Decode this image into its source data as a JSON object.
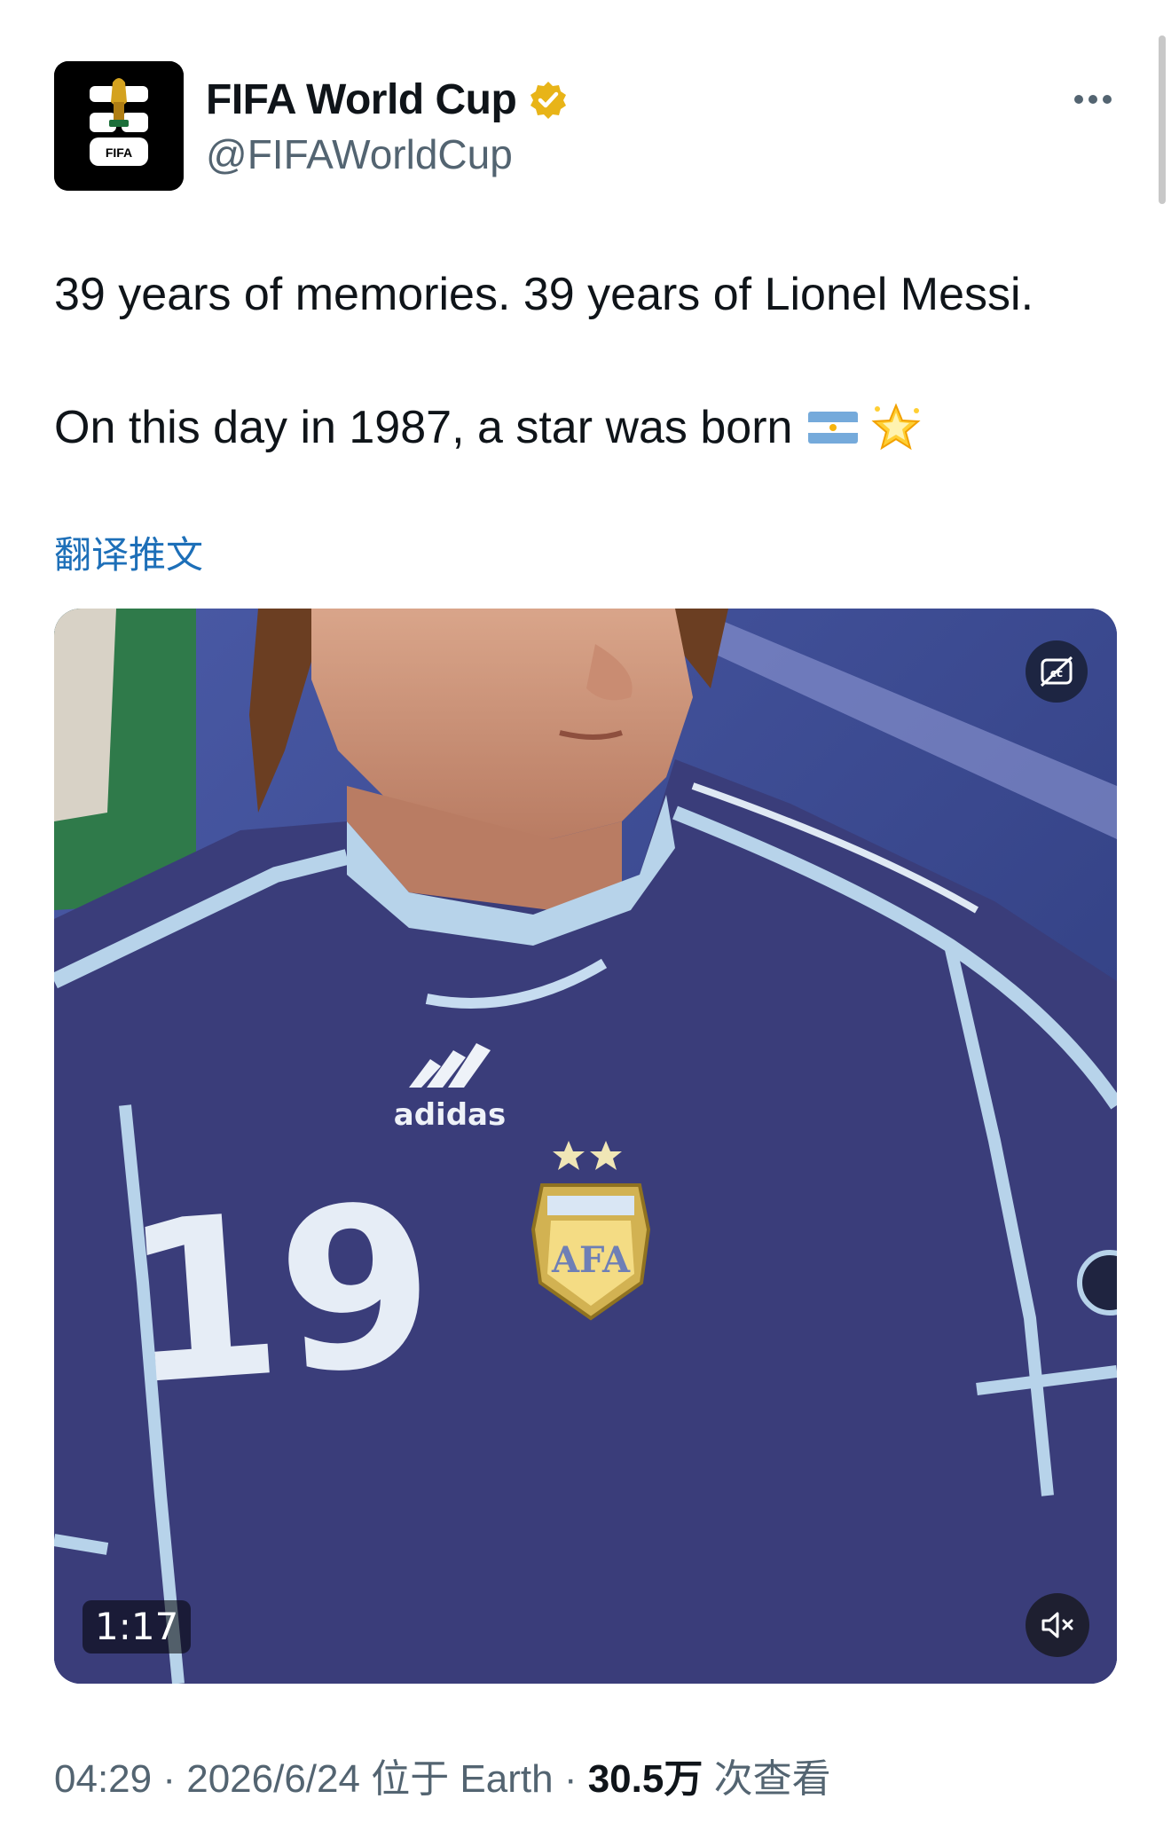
{
  "author": {
    "display_name": "FIFA World Cup",
    "handle": "@FIFAWorldCup",
    "avatar_logo_text": "FIFA",
    "verified_icon": "verified-badge-icon",
    "verified_color": "#e8b418"
  },
  "header": {
    "more_icon": "more-dots-icon"
  },
  "tweet": {
    "line1": "39 years of memories. 39 years of Lionel Messi.",
    "line2": "On this day in 1987, a star was born",
    "emojis": [
      "argentina-flag-icon",
      "glowing-star-icon"
    ],
    "translate_label": "翻译推文"
  },
  "media": {
    "type": "video",
    "jersey_number": "19",
    "jersey_brand": "adidas",
    "crest_text": "AFA",
    "duration": "1:17",
    "cc_icon": "captions-off-icon",
    "mute_icon": "muted-speaker-icon"
  },
  "meta": {
    "time": "04:29",
    "sep1": " · ",
    "date": "2026/6/24",
    "location": " 位于 Earth",
    "sep2": " · ",
    "views_count": "30.5万",
    "views_label": " 次查看"
  },
  "colors": {
    "link": "#1d6fb8",
    "secondary_text": "#536471",
    "primary_text": "#0f1419",
    "jersey_navy": "#3a3d7a",
    "jersey_trim": "#b7d3ea"
  }
}
